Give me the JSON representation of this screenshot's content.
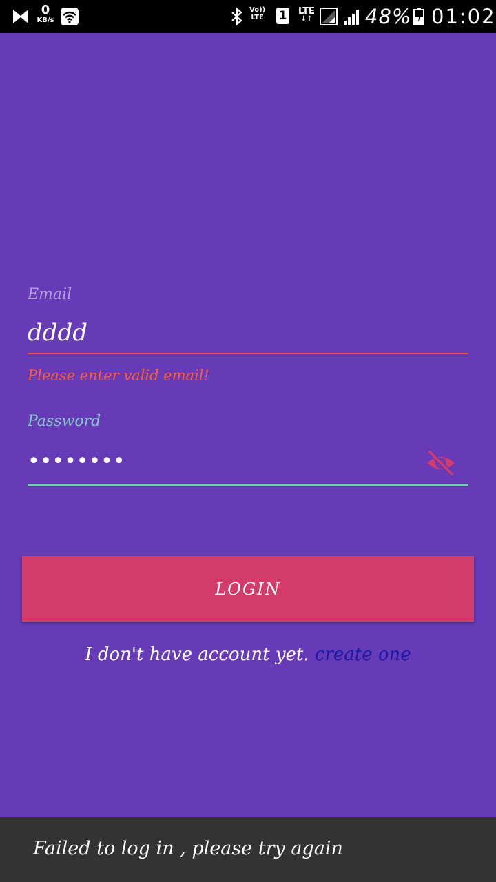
{
  "status_bar": {
    "data_speed_value": "0",
    "data_speed_unit": "KB/s",
    "volte_top": "Vo))",
    "volte_bottom": "LTE",
    "sim_slot": "1",
    "network_type": "LTE",
    "network_arrows": "↓↑",
    "battery_percent": "48%",
    "time": "01:02",
    "icons": [
      "n-logo-icon",
      "wifi-icon",
      "bluetooth-icon",
      "signal-icon",
      "battery-icon"
    ]
  },
  "form": {
    "email_label": "Email",
    "email_value": "dddd",
    "email_error": "Please enter valid email!",
    "password_label": "Password",
    "password_value": "password",
    "visibility_icon": "visibility-off-icon"
  },
  "login_button_label": "LOGIN",
  "signup": {
    "text": "I don't have account yet. ",
    "link_label": "create one"
  },
  "snackbar": {
    "message": "Failed to log in , please try again"
  },
  "colors": {
    "background": "#673ab7",
    "accent": "#d33b6b",
    "error": "#ff5c39",
    "teal": "#80cbc4",
    "link": "#1a1aa6",
    "snackbar": "#333333"
  }
}
